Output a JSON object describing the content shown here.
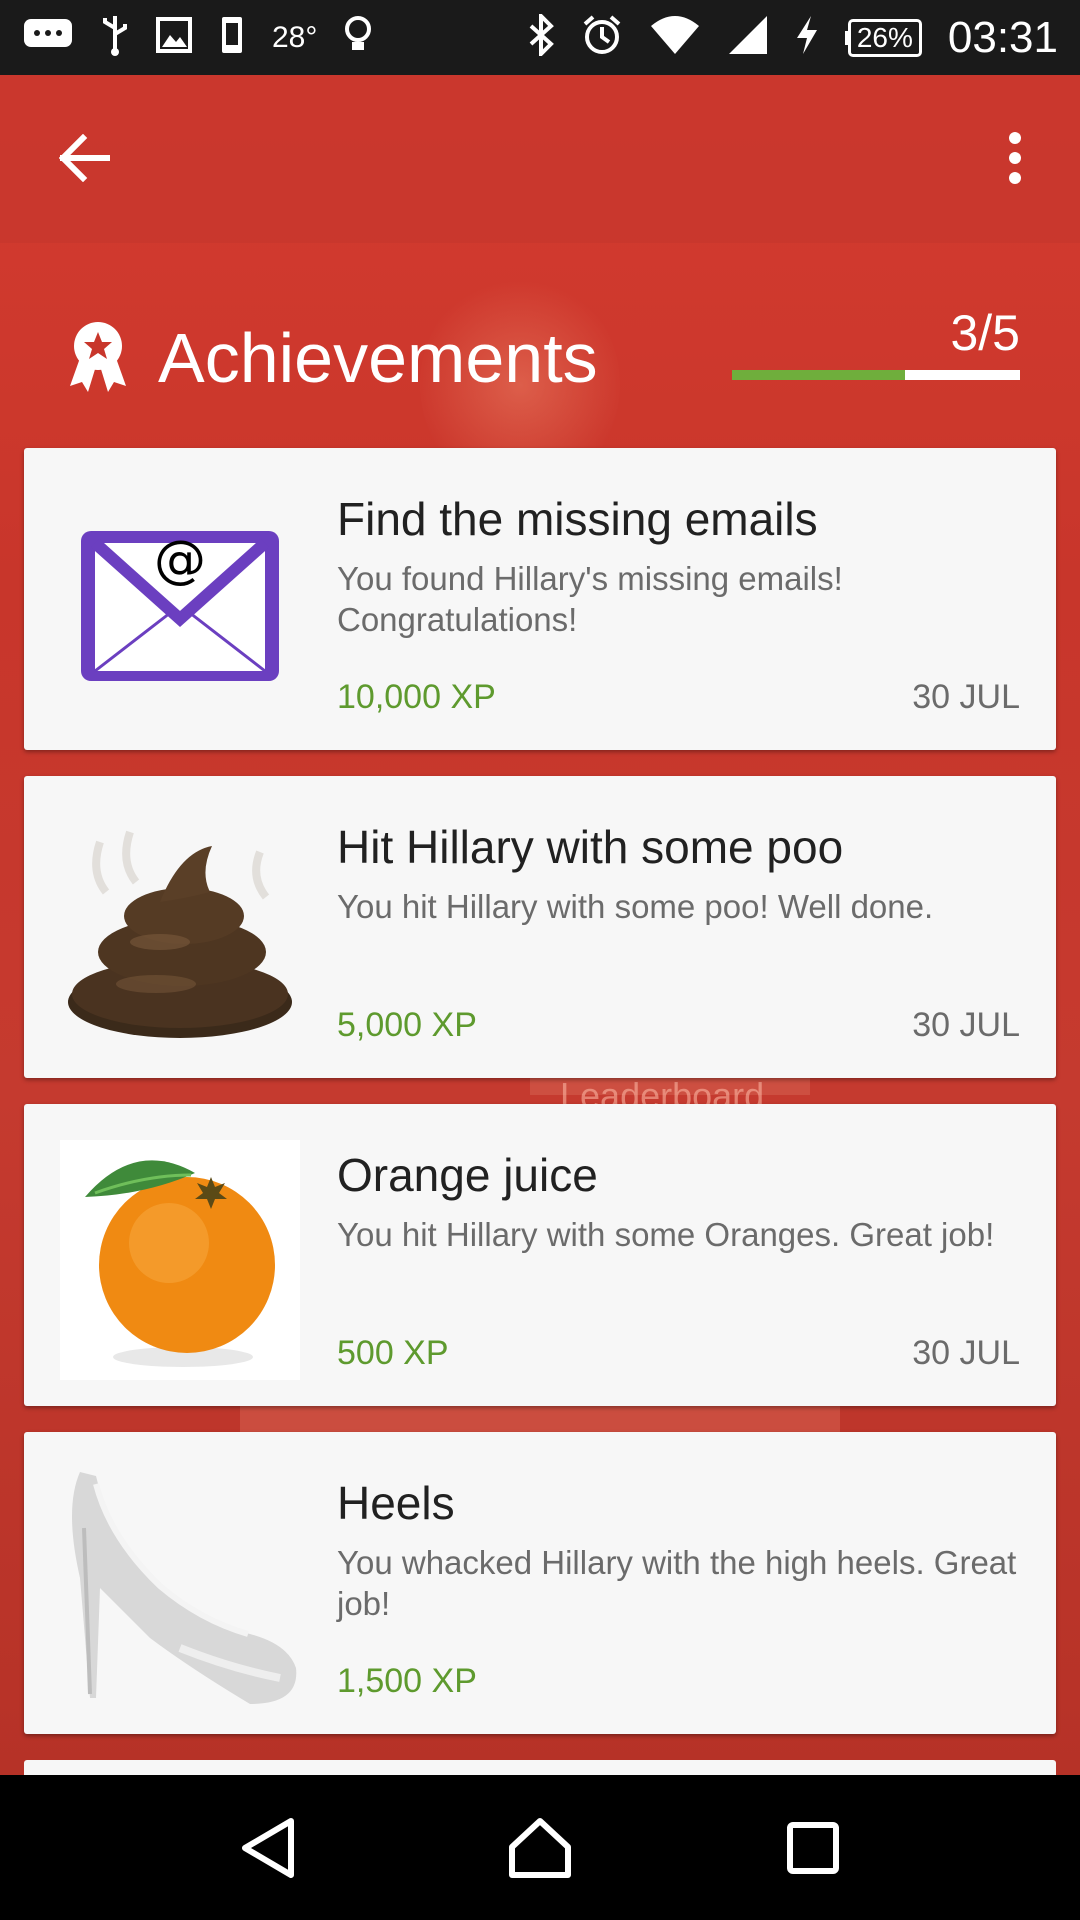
{
  "status_bar": {
    "temperature": "28°",
    "battery": "26%",
    "time": "03:31",
    "icons": [
      "chat-icon",
      "usb-icon",
      "image-icon",
      "device-icon",
      "bulb-icon",
      "bluetooth-icon",
      "alarm-icon",
      "wifi-icon",
      "signal-icon",
      "charging-icon"
    ]
  },
  "toolbar": {
    "back_icon": "arrow-back-icon",
    "menu_icon": "more-vert-icon"
  },
  "header": {
    "title": "Achievements",
    "progress_text": "3/5",
    "progress_fraction": 0.6,
    "progress_color": "#6fae3c"
  },
  "background": {
    "leaderboard_text": "Leaderboard"
  },
  "achievements": [
    {
      "title": "Find the missing emails",
      "description": "You found Hillary's missing emails! Congratulations!",
      "xp": "10,000 XP",
      "date": "30 JUL",
      "icon": "email-icon"
    },
    {
      "title": "Hit Hillary with some poo",
      "description": "You hit Hillary with some poo! Well done.",
      "xp": "5,000 XP",
      "date": "30 JUL",
      "icon": "poo-icon"
    },
    {
      "title": "Orange juice",
      "description": "You hit Hillary with some Oranges. Great job!",
      "xp": "500 XP",
      "date": "30 JUL",
      "icon": "orange-icon"
    },
    {
      "title": "Heels",
      "description": "You whacked Hillary with the high heels. Great job!",
      "xp": "1,500 XP",
      "date": "",
      "icon": "high-heel-icon"
    }
  ],
  "nav_bar": {
    "back": "nav-back-icon",
    "home": "nav-home-icon",
    "recents": "nav-recents-icon"
  },
  "colors": {
    "app_red": "#c8362b",
    "xp_green": "#5e9a2e"
  }
}
